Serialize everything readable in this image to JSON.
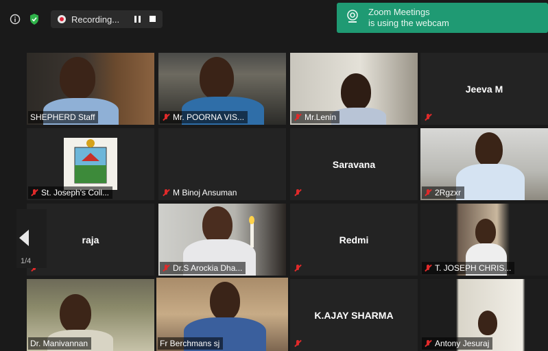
{
  "toolbar": {
    "recording_label": "Recording...",
    "info_icon": "info-icon",
    "shield_icon": "shield-check-icon",
    "pause_icon": "pause-icon",
    "stop_icon": "stop-icon"
  },
  "notification": {
    "line1": "Zoom Meetings",
    "line2": "is using the webcam",
    "icon": "webcam-icon",
    "color": "#1f9a73"
  },
  "pager": {
    "label": "1/4"
  },
  "participants": [
    {
      "name": "SHEPHERD Staff",
      "muted": false
    },
    {
      "name": "Mr. POORNA VIS...",
      "muted": true
    },
    {
      "name": "Mr.Lenin",
      "muted": true
    },
    {
      "name": "Jeeva M",
      "muted": true
    },
    {
      "name": "St. Joseph's Coll...",
      "muted": true
    },
    {
      "name": "M Binoj Ansuman",
      "muted": true
    },
    {
      "name": "Saravana",
      "muted": true
    },
    {
      "name": "2Rgzxr",
      "muted": true
    },
    {
      "name": "raja",
      "muted": true
    },
    {
      "name": "Dr.S Arockia Dha...",
      "muted": true
    },
    {
      "name": "Redmi",
      "muted": true
    },
    {
      "name": "T. JOSEPH CHRIS...",
      "muted": true
    },
    {
      "name": "Dr. Manivannan",
      "muted": false
    },
    {
      "name": "Fr Berchmans sj",
      "muted": false
    },
    {
      "name": "K.AJAY SHARMA",
      "muted": true
    },
    {
      "name": "Antony Jesuraj",
      "muted": true
    }
  ],
  "colors": {
    "accent_active": "#c8e06b",
    "mute_red": "#e02a2a"
  }
}
